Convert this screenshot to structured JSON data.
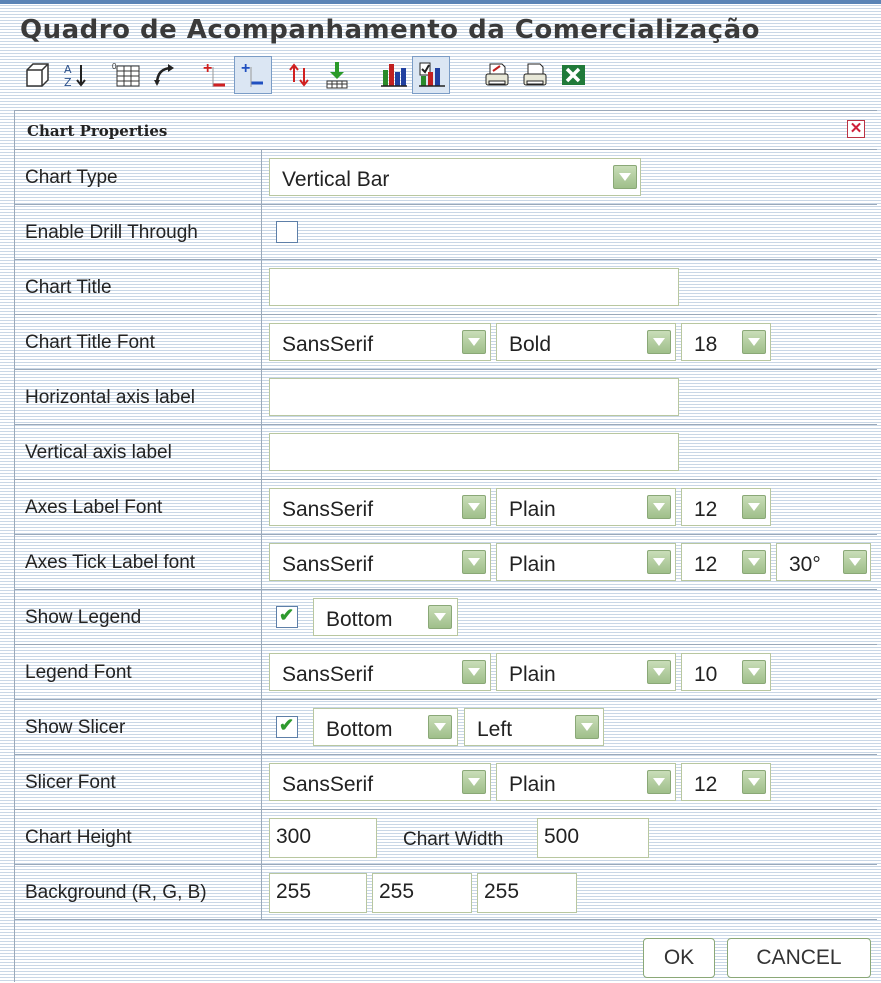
{
  "app": {
    "title": "Quadro de Acompanhamento da Comercialização"
  },
  "toolbar": {
    "items": [
      {
        "name": "cube-icon"
      },
      {
        "name": "sort-az-icon"
      },
      {
        "name": "table-icon"
      },
      {
        "name": "swap-axes-icon"
      },
      {
        "name": "expand-rows-icon"
      },
      {
        "name": "collapse-rows-icon"
      },
      {
        "name": "swap-arrows-icon"
      },
      {
        "name": "download-icon"
      },
      {
        "name": "bar-chart-icon"
      },
      {
        "name": "chart-properties-icon"
      },
      {
        "name": "print-setup-icon"
      },
      {
        "name": "print-icon"
      },
      {
        "name": "excel-export-icon"
      }
    ]
  },
  "dialog": {
    "title": "Chart Properties",
    "close_icon": "close-icon",
    "rows": {
      "chart_type": {
        "label": "Chart Type",
        "value": "Vertical Bar"
      },
      "drill_through": {
        "label": "Enable Drill Through"
      },
      "chart_title": {
        "label": "Chart Title",
        "value": ""
      },
      "chart_title_font": {
        "label": "Chart Title Font",
        "family": "SansSerif",
        "style": "Bold",
        "size": "18"
      },
      "h_axis_label": {
        "label": "Horizontal axis label",
        "value": ""
      },
      "v_axis_label": {
        "label": "Vertical axis label",
        "value": ""
      },
      "axes_label_font": {
        "label": "Axes Label Font",
        "family": "SansSerif",
        "style": "Plain",
        "size": "12"
      },
      "axes_tick_font": {
        "label": "Axes Tick Label font",
        "family": "SansSerif",
        "style": "Plain",
        "size": "12",
        "angle": "30°"
      },
      "show_legend": {
        "label": "Show Legend",
        "position": "Bottom"
      },
      "legend_font": {
        "label": "Legend Font",
        "family": "SansSerif",
        "style": "Plain",
        "size": "10"
      },
      "show_slicer": {
        "label": "Show Slicer",
        "position": "Bottom",
        "align": "Left"
      },
      "slicer_font": {
        "label": "Slicer Font",
        "family": "SansSerif",
        "style": "Plain",
        "size": "12"
      },
      "chart_size": {
        "label": "Chart Height",
        "height": "300",
        "width_label": "Chart Width",
        "width": "500"
      },
      "background": {
        "label": "Background (R, G, B)",
        "r": "255",
        "g": "255",
        "b": "255"
      }
    },
    "buttons": {
      "ok": "OK",
      "cancel": "CANCEL"
    }
  },
  "colors": {
    "accent": "#5b84b6",
    "dropdown_green": "#9fbf8a",
    "close_red": "#d0203a"
  }
}
